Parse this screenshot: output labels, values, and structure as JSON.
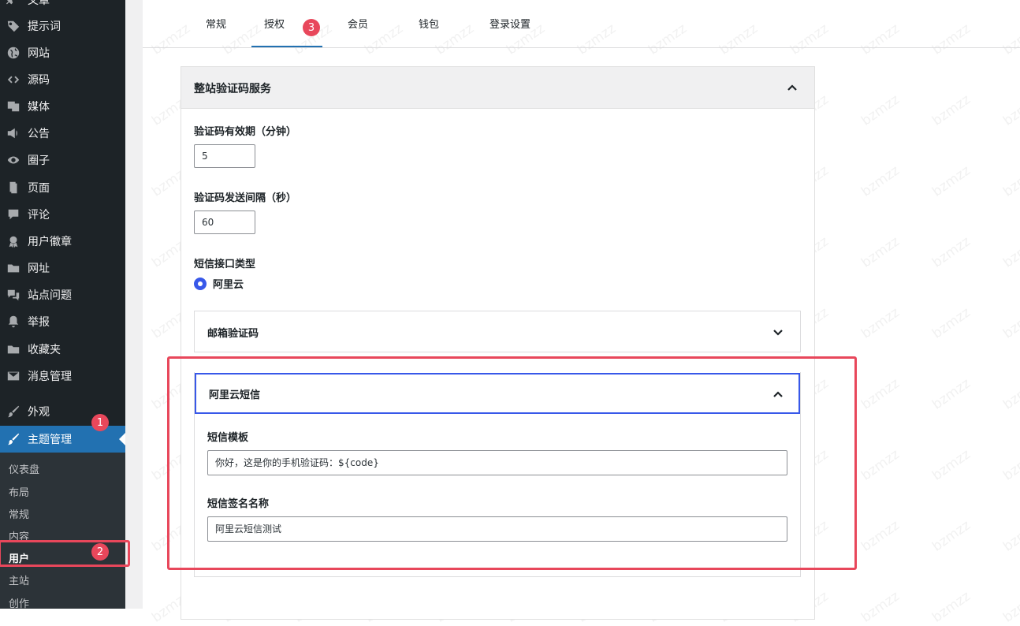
{
  "sidebar": {
    "items": [
      {
        "label": "文章",
        "icon": "pin-icon"
      },
      {
        "label": "提示词",
        "icon": "tag-icon"
      },
      {
        "label": "网站",
        "icon": "globe-icon"
      },
      {
        "label": "源码",
        "icon": "code-icon"
      },
      {
        "label": "媒体",
        "icon": "media-icon"
      },
      {
        "label": "公告",
        "icon": "megaphone-icon"
      },
      {
        "label": "圈子",
        "icon": "visibility-icon"
      },
      {
        "label": "页面",
        "icon": "page-icon"
      },
      {
        "label": "评论",
        "icon": "comment-icon"
      },
      {
        "label": "用户徽章",
        "icon": "badge-icon"
      },
      {
        "label": "网址",
        "icon": "folder-icon"
      },
      {
        "label": "站点问题",
        "icon": "feedback-icon"
      },
      {
        "label": "举报",
        "icon": "bell-icon"
      },
      {
        "label": "收藏夹",
        "icon": "folder-icon"
      },
      {
        "label": "消息管理",
        "icon": "email-icon"
      },
      {
        "label": "外观",
        "icon": "brush-icon"
      },
      {
        "label": "主题管理",
        "icon": "brush-icon"
      }
    ],
    "submenu": [
      "仪表盘",
      "布局",
      "常规",
      "内容",
      "用户",
      "主站",
      "创作"
    ]
  },
  "tabs": [
    "常规",
    "授权",
    "会员",
    "钱包",
    "登录设置"
  ],
  "panel": {
    "title": "整站验证码服务",
    "expiry_label": "验证码有效期（分钟）",
    "expiry_value": "5",
    "interval_label": "验证码发送间隔（秒）",
    "interval_value": "60",
    "sms_type_label": "短信接口类型",
    "sms_type_option": "阿里云",
    "email_section_title": "邮箱验证码",
    "aliyun_section_title": "阿里云短信",
    "template_label": "短信模板",
    "template_value": "你好，这是你的手机验证码：${code}",
    "sign_label": "短信签名名称",
    "sign_value": "阿里云短信测试"
  },
  "annotations": {
    "badge1": "1",
    "badge2": "2",
    "badge3": "3",
    "color": "#e8475b"
  },
  "watermark": "bzmzz",
  "colors": {
    "sidebar_bg": "#1d2327",
    "active_bg": "#2271b1",
    "focus": "#3858e9"
  }
}
